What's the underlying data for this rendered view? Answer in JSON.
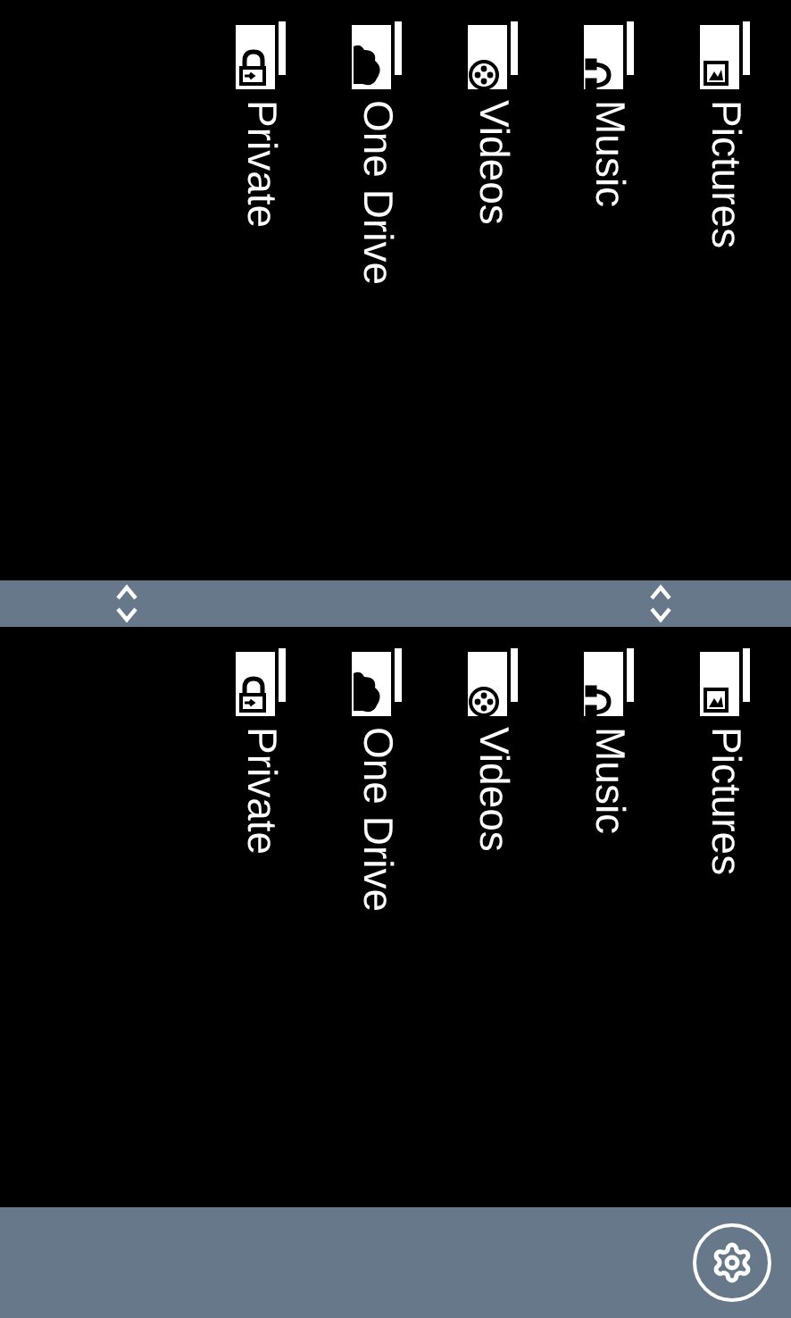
{
  "panes": [
    {
      "items": [
        {
          "label": "Pictures",
          "kind": "pictures"
        },
        {
          "label": "Music",
          "kind": "music"
        },
        {
          "label": "Videos",
          "kind": "videos"
        },
        {
          "label": "One Drive",
          "kind": "cloud"
        },
        {
          "label": "Private",
          "kind": "private"
        }
      ]
    },
    {
      "items": [
        {
          "label": "Pictures",
          "kind": "pictures"
        },
        {
          "label": "Music",
          "kind": "music"
        },
        {
          "label": "Videos",
          "kind": "videos"
        },
        {
          "label": "One Drive",
          "kind": "cloud"
        },
        {
          "label": "Private",
          "kind": "private"
        }
      ]
    }
  ]
}
